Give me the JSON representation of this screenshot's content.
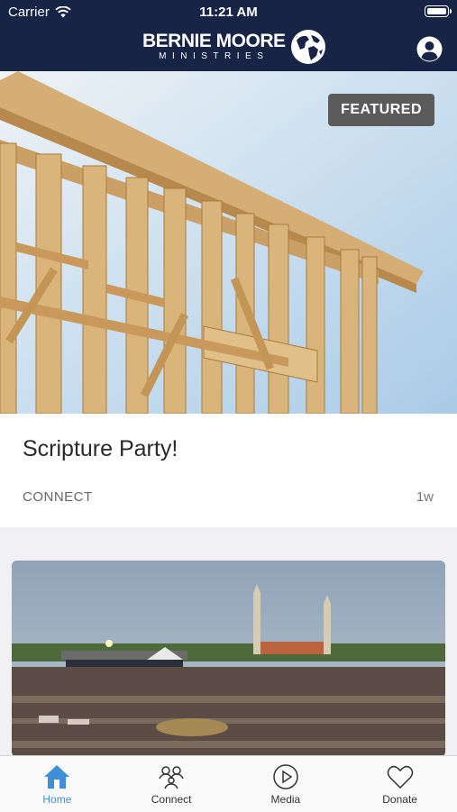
{
  "status": {
    "carrier": "Carrier",
    "time": "11:21 AM"
  },
  "header": {
    "logo_title": "BERNIE MOORE",
    "logo_subtitle": "MINISTRIES"
  },
  "featured": {
    "badge": "FEATURED",
    "title": "Scripture Party!",
    "category": "CONNECT",
    "age": "1w"
  },
  "tabs": [
    {
      "label": "Home",
      "icon": "home-icon",
      "active": true
    },
    {
      "label": "Connect",
      "icon": "people-icon",
      "active": false
    },
    {
      "label": "Media",
      "icon": "play-icon",
      "active": false
    },
    {
      "label": "Donate",
      "icon": "heart-icon",
      "active": false
    }
  ],
  "colors": {
    "nav": "#172445",
    "accent": "#3f8fd6",
    "badge": "#5b5b5b"
  }
}
